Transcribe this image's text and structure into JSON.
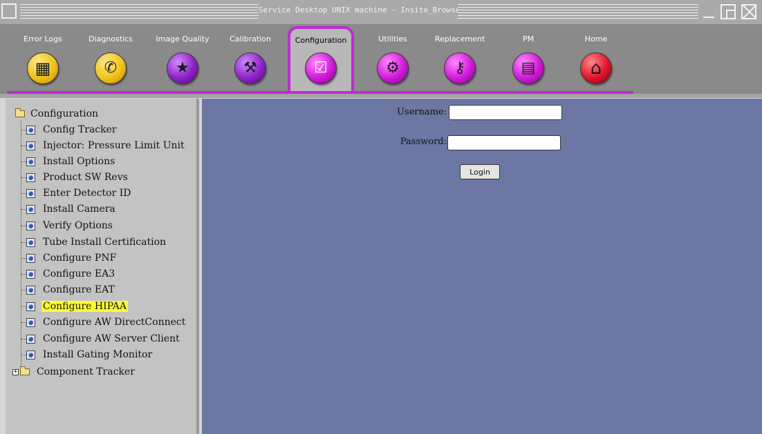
{
  "window": {
    "title": "Service Desktop UNIX machine - Insite_Browser"
  },
  "toolbar": {
    "tabs": [
      {
        "label": "Error Logs",
        "icon": "error-logs-icon",
        "color": "#f1c21b",
        "glyph": "▦",
        "active": false
      },
      {
        "label": "Diagnostics",
        "icon": "stethoscope-icon",
        "color": "#f1c21b",
        "glyph": "✆",
        "active": false
      },
      {
        "label": "Image Quality",
        "icon": "image-quality-icon",
        "color": "#8f22c6",
        "glyph": "★",
        "active": false
      },
      {
        "label": "Calibration",
        "icon": "calibration-icon",
        "color": "#8f22c6",
        "glyph": "⚒",
        "active": false
      },
      {
        "label": "Configuration",
        "icon": "checklist-icon",
        "color": "#d11ad9",
        "glyph": "☑",
        "active": true
      },
      {
        "label": "Utilities",
        "icon": "toolbox-icon",
        "color": "#d11ad9",
        "glyph": "⚙",
        "active": false
      },
      {
        "label": "Replacement",
        "icon": "wrench-icon",
        "color": "#d11ad9",
        "glyph": "⚷",
        "active": false
      },
      {
        "label": "PM",
        "icon": "pm-clipboard-icon",
        "color": "#d11ad9",
        "glyph": "▤",
        "active": false
      },
      {
        "label": "Home",
        "icon": "home-icon",
        "color": "#e0142a",
        "glyph": "⌂",
        "active": false
      }
    ],
    "accent_color": "#c22ad6"
  },
  "tree": {
    "root_label": "Configuration",
    "items": [
      {
        "label": "Config Tracker",
        "selected": false
      },
      {
        "label": "Injector: Pressure Limit Unit",
        "selected": false
      },
      {
        "label": "Install Options",
        "selected": false
      },
      {
        "label": "Product SW Revs",
        "selected": false
      },
      {
        "label": "Enter Detector ID",
        "selected": false
      },
      {
        "label": "Install Camera",
        "selected": false
      },
      {
        "label": "Verify Options",
        "selected": false
      },
      {
        "label": "Tube Install Certification",
        "selected": false
      },
      {
        "label": "Configure PNF",
        "selected": false
      },
      {
        "label": "Configure EA3",
        "selected": false
      },
      {
        "label": "Configure EAT",
        "selected": false
      },
      {
        "label": "Configure HIPAA",
        "selected": true
      },
      {
        "label": "Configure AW DirectConnect",
        "selected": false
      },
      {
        "label": "Configure AW Server Client",
        "selected": false
      },
      {
        "label": "Install Gating Monitor",
        "selected": false
      }
    ],
    "collapsed_folder": {
      "label": "Component Tracker",
      "expander": "+"
    }
  },
  "login": {
    "username_label": "Username:",
    "username_value": "",
    "password_label": "Password:",
    "password_value": "",
    "button_label": "Login"
  }
}
